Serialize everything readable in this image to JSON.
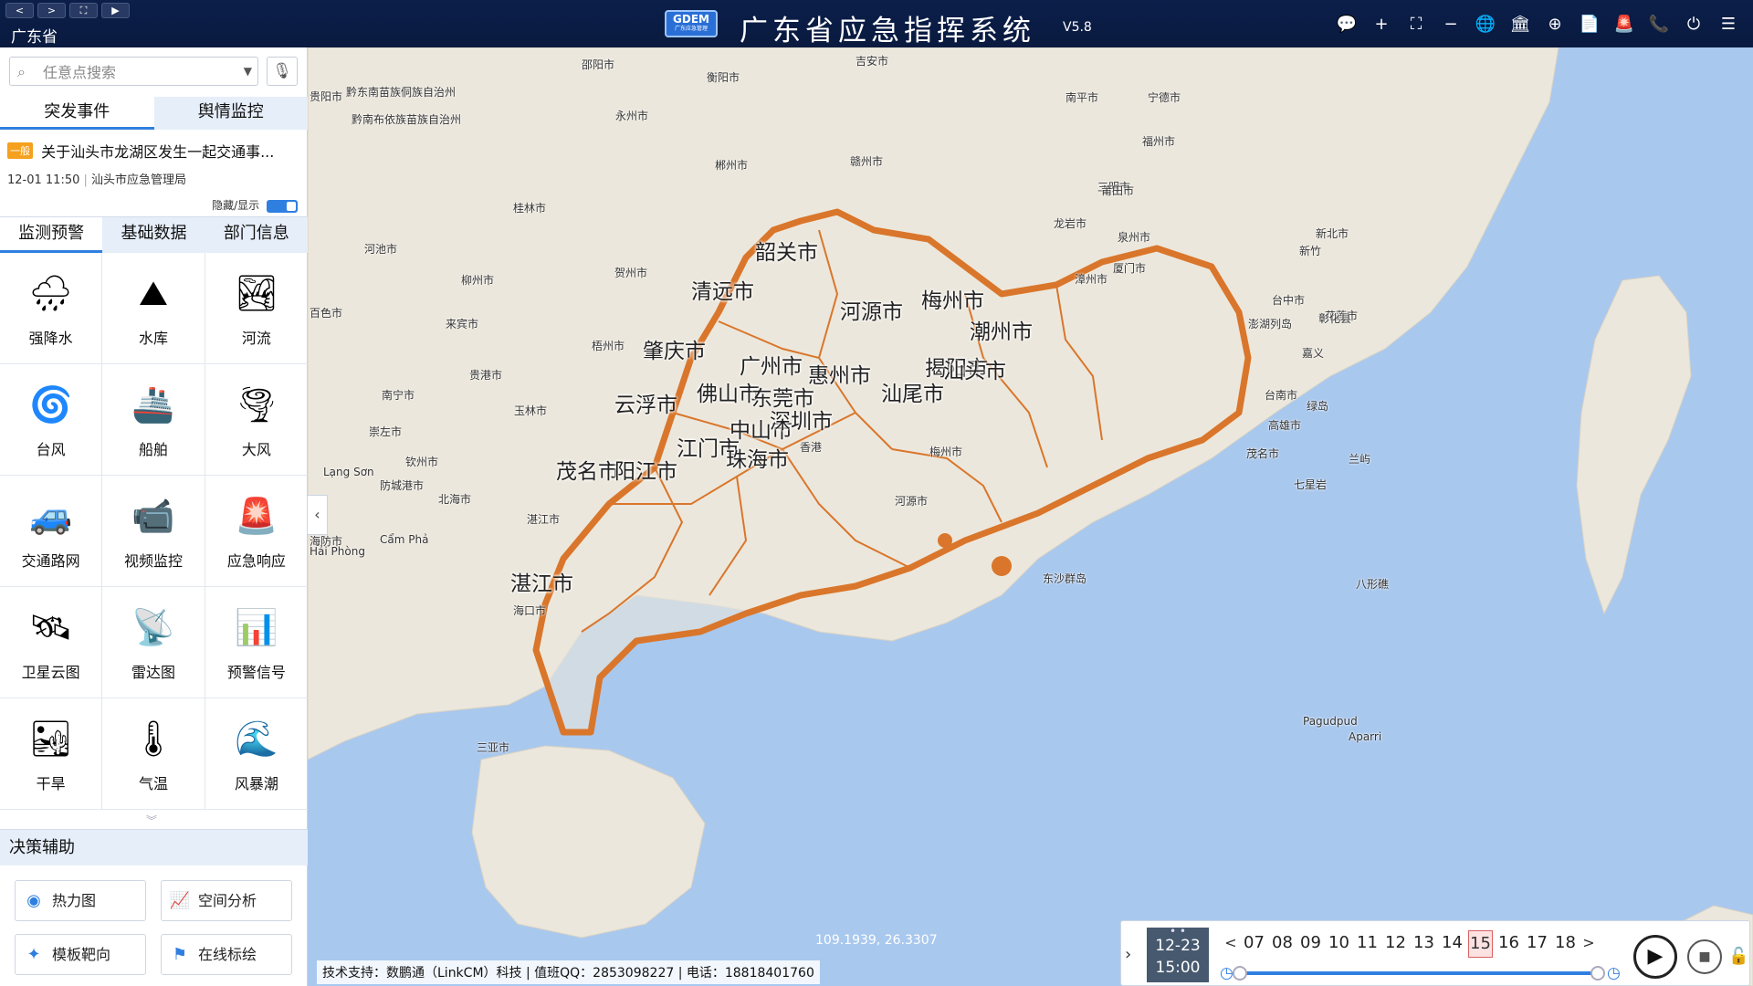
{
  "header": {
    "region": "广东省",
    "logo_text": "GDEM",
    "logo_sub": "广东应急管理",
    "title": "广东省应急指挥系统",
    "version": "V5.8",
    "nav": [
      "<",
      ">",
      "⛶",
      "▶"
    ],
    "tools": [
      {
        "name": "chat-icon",
        "glyph": "💬"
      },
      {
        "name": "plus-icon",
        "glyph": "+"
      },
      {
        "name": "fullscreen-icon",
        "glyph": "⛶"
      },
      {
        "name": "minus-icon",
        "glyph": "−"
      },
      {
        "name": "globe-icon",
        "glyph": "🌐"
      },
      {
        "name": "bank-icon",
        "glyph": "🏛"
      },
      {
        "name": "medkit-icon",
        "glyph": "⊕"
      },
      {
        "name": "document-icon",
        "glyph": "📄"
      },
      {
        "name": "alarm-icon",
        "glyph": "🚨"
      },
      {
        "name": "phone-icon",
        "glyph": "📞"
      },
      {
        "name": "power-icon",
        "glyph": "⏻"
      },
      {
        "name": "menu-icon",
        "glyph": "☰"
      }
    ]
  },
  "search": {
    "placeholder": "任意点搜索"
  },
  "event_tabs": [
    "突发事件",
    "舆情监控"
  ],
  "event": {
    "level": "一般",
    "title": "关于汕头市龙湖区发生一起交通事...",
    "time": "12-01 11:50",
    "source": "汕头市应急管理局",
    "toggle_label": "隐藏/显示"
  },
  "category_tabs": [
    "监测预警",
    "基础数据",
    "部门信息"
  ],
  "grid_items": [
    {
      "label": "强降水",
      "icon": "rain-icon",
      "glyph": "🌧"
    },
    {
      "label": "水库",
      "icon": "reservoir-icon",
      "glyph": "⛰"
    },
    {
      "label": "河流",
      "icon": "river-icon",
      "glyph": "🏞"
    },
    {
      "label": "台风",
      "icon": "typhoon-icon",
      "glyph": "🌀"
    },
    {
      "label": "船舶",
      "icon": "ship-icon",
      "glyph": "🚢"
    },
    {
      "label": "大风",
      "icon": "wind-icon",
      "glyph": "🌪"
    },
    {
      "label": "交通路网",
      "icon": "traffic-icon",
      "glyph": "🚙"
    },
    {
      "label": "视频监控",
      "icon": "camera-icon",
      "glyph": "📹"
    },
    {
      "label": "应急响应",
      "icon": "siren-icon",
      "glyph": "🚨"
    },
    {
      "label": "卫星云图",
      "icon": "satellite-icon",
      "glyph": "🛰"
    },
    {
      "label": "雷达图",
      "icon": "radar-icon",
      "glyph": "📡"
    },
    {
      "label": "预警信号",
      "icon": "signal-board-icon",
      "glyph": "📊"
    },
    {
      "label": "干旱",
      "icon": "drought-icon",
      "glyph": "🏜"
    },
    {
      "label": "气温",
      "icon": "thermometer-icon",
      "glyph": "🌡"
    },
    {
      "label": "风暴潮",
      "icon": "storm-surge-icon",
      "glyph": "🌊"
    }
  ],
  "decision": {
    "title": "决策辅助",
    "tools": [
      {
        "label": "热力图",
        "icon": "heatmap-icon",
        "glyph": "◉"
      },
      {
        "label": "空间分析",
        "icon": "analysis-icon",
        "glyph": "📈"
      },
      {
        "label": "模板靶向",
        "icon": "target-icon",
        "glyph": "✦"
      },
      {
        "label": "在线标绘",
        "icon": "flag-icon",
        "glyph": "⚑"
      }
    ]
  },
  "map": {
    "cities": [
      "韶关市",
      "清远市",
      "河源市",
      "梅州市",
      "潮州市",
      "肇庆市",
      "广州市",
      "惠州市",
      "揭阳市",
      "汕头市",
      "云浮市",
      "佛山市",
      "东莞市",
      "汕尾市",
      "中山市",
      "深圳市",
      "江门市",
      "珠海市",
      "茂名市",
      "阳江市",
      "湛江市"
    ],
    "places": [
      "邵阳市",
      "衡阳市",
      "吉安市",
      "贵阳市",
      "黔东南苗族侗族自治州",
      "黔南布依族苗族自治州",
      "永州市",
      "郴州市",
      "赣州市",
      "南平市",
      "宁德市",
      "福州市",
      "三明市",
      "桂林市",
      "河池市",
      "柳州市",
      "贺州市",
      "龙岩市",
      "泉州市",
      "莆田市",
      "漳州市",
      "厦门市",
      "新北市",
      "新竹",
      "台中市",
      "花莲市",
      "彰化县",
      "澎湖列岛",
      "百色市",
      "来宾市",
      "梧州市",
      "贵港市",
      "南宁市",
      "玉林市",
      "崇左市",
      "钦州市",
      "防城港市",
      "北海市",
      "湛江市",
      "海口市",
      "三亚市",
      "香港",
      "嘉义",
      "台南市",
      "高雄市",
      "绿岛",
      "兰屿",
      "七星岩",
      "八形礁",
      "Lạng Sơn",
      "海防市",
      "Hải Phòng",
      "Cẩm Phả",
      "Pagudpud",
      "Aparri",
      "河源市",
      "茂名市",
      "梅州市",
      "东沙群岛"
    ],
    "coords": "109.1939, 26.3307",
    "credits": "技术支持：数鹏通（LinkCM）科技 | 值班QQ：2853098227 | 电话：18818401760"
  },
  "timeline": {
    "date": "12-23",
    "time": "15:00",
    "hours": [
      "07",
      "08",
      "09",
      "10",
      "11",
      "12",
      "13",
      "14",
      "15",
      "16",
      "17",
      "18"
    ],
    "active_hour": "15",
    "prev": "<",
    "next": ">"
  },
  "colors": {
    "header_bg": "#0b1f4a",
    "accent": "#2f7fe0",
    "boundary": "#d9762b",
    "sea": "#a9c8ee",
    "land": "#ece7dc"
  }
}
